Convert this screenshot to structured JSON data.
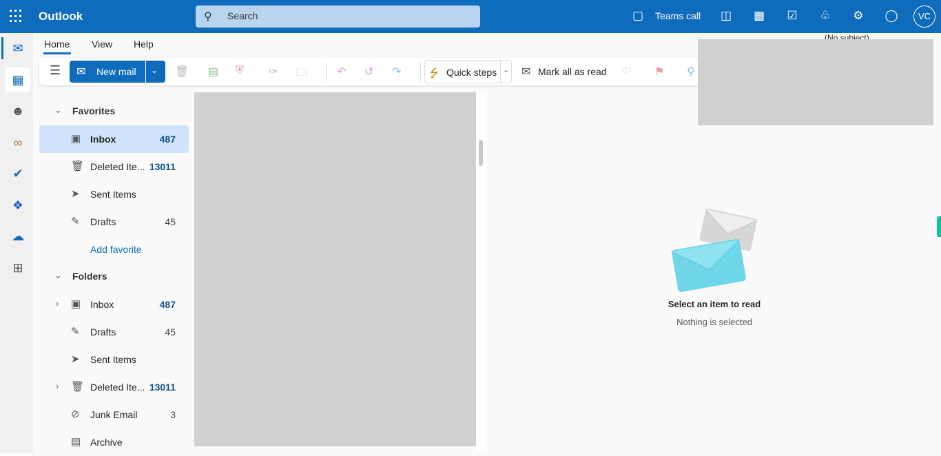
{
  "app": {
    "title": "Outlook",
    "search_placeholder": "Search",
    "teams_call": "Teams call",
    "avatar_initials": "VC",
    "accent": "#0f6cbd"
  },
  "tabs": [
    {
      "label": "Home",
      "active": true
    },
    {
      "label": "View"
    },
    {
      "label": "Help"
    }
  ],
  "toolbar": {
    "new_mail": "New mail",
    "quick_steps": "Quick steps",
    "mark_all_read": "Mark all as read"
  },
  "reading_header": {
    "subject": "(No subject)"
  },
  "favorites": {
    "label": "Favorites",
    "items": [
      {
        "label": "Inbox",
        "count": "487",
        "icon": "inbox-icon",
        "selected": true
      },
      {
        "label": "Deleted Ite...",
        "count": "13011",
        "icon": "trash-icon"
      },
      {
        "label": "Sent Items",
        "count": "",
        "icon": "send-icon"
      },
      {
        "label": "Drafts",
        "count": "45",
        "icon": "drafts-icon"
      }
    ],
    "add_favorite": "Add favorite"
  },
  "folders": {
    "label": "Folders",
    "items": [
      {
        "label": "Inbox",
        "count": "487",
        "icon": "inbox-icon",
        "expandable": true
      },
      {
        "label": "Drafts",
        "count": "45",
        "icon": "drafts-icon"
      },
      {
        "label": "Sent Items",
        "count": "",
        "icon": "send-icon"
      },
      {
        "label": "Deleted Ite...",
        "count": "13011",
        "icon": "trash-icon",
        "expandable": true
      },
      {
        "label": "Junk Email",
        "count": "3",
        "icon": "junk-icon"
      },
      {
        "label": "Archive",
        "count": "",
        "icon": "archive-icon"
      }
    ]
  },
  "reading_pane": {
    "title": "Select an item to read",
    "subtitle": "Nothing is selected"
  }
}
